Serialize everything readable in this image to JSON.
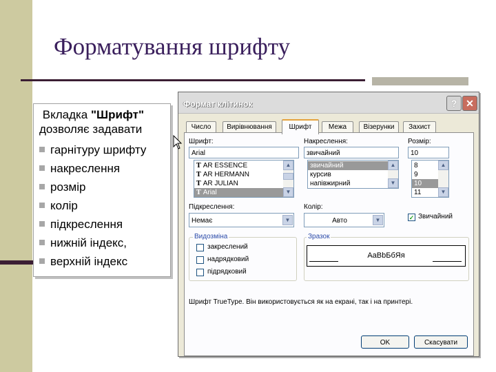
{
  "slide": {
    "title": "Форматування шрифту",
    "text_lead": "Вкладка ",
    "text_bold": "\"Шрифт\"",
    "text_rest": "дозволяє  задавати",
    "bullets": [
      "гарнітуру шрифту",
      "накреслення",
      "розмір",
      "колір",
      "підкреслення",
      "нижній індекс,",
      "верхній індекс"
    ]
  },
  "dialog": {
    "title": "Формат клітинок",
    "help_label": "?",
    "close_label": "✕",
    "tabs": [
      "Число",
      "Вирівнювання",
      "Шрифт",
      "Межа",
      "Візерунки",
      "Захист"
    ],
    "active_tab": "Шрифт",
    "font": {
      "label": "Шрифт:",
      "value": "Arial",
      "items": [
        "AR ESSENCE",
        "AR HERMANN",
        "AR JULIAN",
        "Arial"
      ],
      "selected": "Arial",
      "item_icon": "truetype-icon",
      "icon_glyph": "T"
    },
    "style": {
      "label": "Накреслення:",
      "value": "звичайний",
      "items": [
        "звичайний",
        "курсив",
        "напівжирний"
      ],
      "selected": "звичайний"
    },
    "size": {
      "label": "Розмір:",
      "value": "10",
      "items": [
        "8",
        "9",
        "10",
        "11"
      ],
      "selected": "10"
    },
    "underline": {
      "label": "Підкреслення:",
      "value": "Немає"
    },
    "color": {
      "label": "Колір:",
      "value": "Авто"
    },
    "normal_font": {
      "label": "Звичайний",
      "checked": true
    },
    "effects": {
      "caption": "Видозміна",
      "items": [
        {
          "label": "закреслений",
          "checked": false
        },
        {
          "label": "надрядковий",
          "checked": false
        },
        {
          "label": "підрядковий",
          "checked": false
        }
      ]
    },
    "preview": {
      "caption": "Зразок",
      "text": "AaBbБбЯя"
    },
    "info": "Шрифт TrueType. Він використовується як на екрані, так і на принтері.",
    "ok_label": "OK",
    "cancel_label": "Скасувати"
  },
  "colors": {
    "band": "#cdcaa0",
    "title": "#3a1f5c",
    "accent_line": "#3b1e33",
    "selection": "#999999",
    "group_caption": "#2a4aa8"
  }
}
